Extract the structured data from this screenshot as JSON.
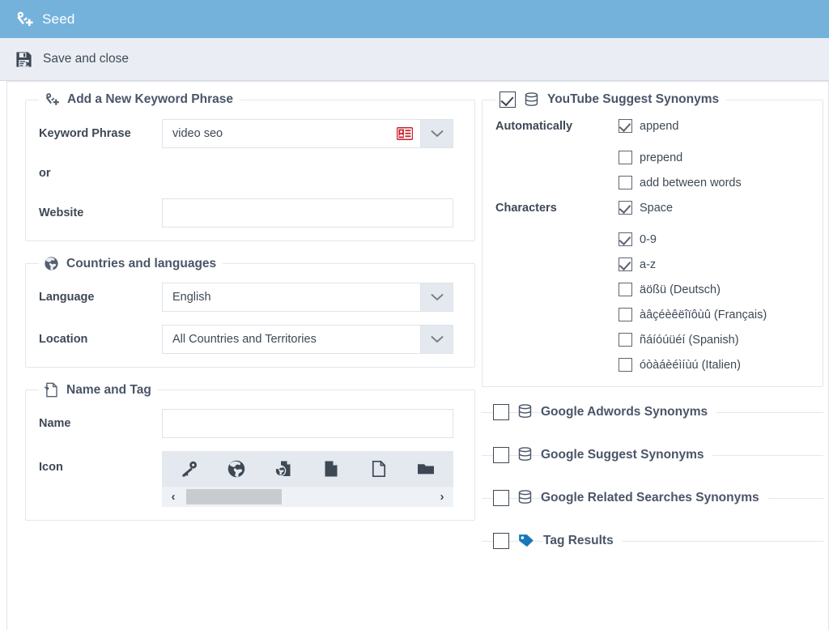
{
  "window": {
    "title": "Seed",
    "title_icon": "key-plus-icon",
    "titlebar_color": "#74b2dc"
  },
  "toolbar": {
    "save_and_close_label": "Save and close",
    "save_and_close_icon": "floppy-disk-delete-icon"
  },
  "left_panel": {
    "keyword_section": {
      "legend": "Add a New Keyword Phrase",
      "legend_icon": "key-plus-icon",
      "keyword_label": "Keyword Phrase",
      "keyword_value": "video seo",
      "keyword_trailing_icon": "contact-card-icon",
      "keyword_trailing_icon_color": "#c8202b",
      "dropdown_icon": "chevron-down-icon",
      "or_label": "or",
      "website_label": "Website",
      "website_value": ""
    },
    "countries_section": {
      "legend": "Countries and languages",
      "legend_icon": "globe-icon",
      "language_label": "Language",
      "language_value": "English",
      "location_label": "Location",
      "location_value": "All Countries and Territories"
    },
    "name_tag_section": {
      "legend": "Name and Tag",
      "legend_icon": "document-tag-icon",
      "name_label": "Name",
      "name_value": "",
      "icon_label": "Icon",
      "icons": [
        "key-icon",
        "globe-icon",
        "globe-document-icon",
        "document-filled-icon",
        "document-outline-icon",
        "folder-icon"
      ],
      "scroll_left_icon": "chevron-left-icon",
      "scroll_right_icon": "chevron-right-icon"
    }
  },
  "right_panel": {
    "youtube_section": {
      "legend": "YouTube Suggest Synonyms",
      "legend_icon": "database-icon",
      "checked": true,
      "automatically_label": "Automatically",
      "automatically_options": [
        {
          "label": "append",
          "checked": true
        },
        {
          "label": "prepend",
          "checked": false
        },
        {
          "label": "add between words",
          "checked": false
        }
      ],
      "characters_label": "Characters",
      "characters_options": [
        {
          "label": "Space",
          "checked": true
        },
        {
          "label": "0-9",
          "checked": true
        },
        {
          "label": "a-z",
          "checked": true
        },
        {
          "label": "äößü (Deutsch)",
          "checked": false
        },
        {
          "label": "àâçéèêëîïôùû (Français)",
          "checked": false
        },
        {
          "label": "ñáíóúüéí (Spanish)",
          "checked": false
        },
        {
          "label": "óòàáèéìíùú (Italien)",
          "checked": false
        }
      ]
    },
    "collapsed_sections": [
      {
        "label": "Google Adwords Synonyms",
        "icon": "database-icon",
        "checked": false,
        "icon_color": "#4a5568"
      },
      {
        "label": "Google Suggest Synonyms",
        "icon": "database-icon",
        "checked": false,
        "icon_color": "#4a5568"
      },
      {
        "label": "Google Related Searches Synonyms",
        "icon": "database-icon",
        "checked": false,
        "icon_color": "#4a5568"
      },
      {
        "label": "Tag Results",
        "icon": "tag-icon",
        "checked": false,
        "icon_color": "#1878b9"
      }
    ]
  }
}
